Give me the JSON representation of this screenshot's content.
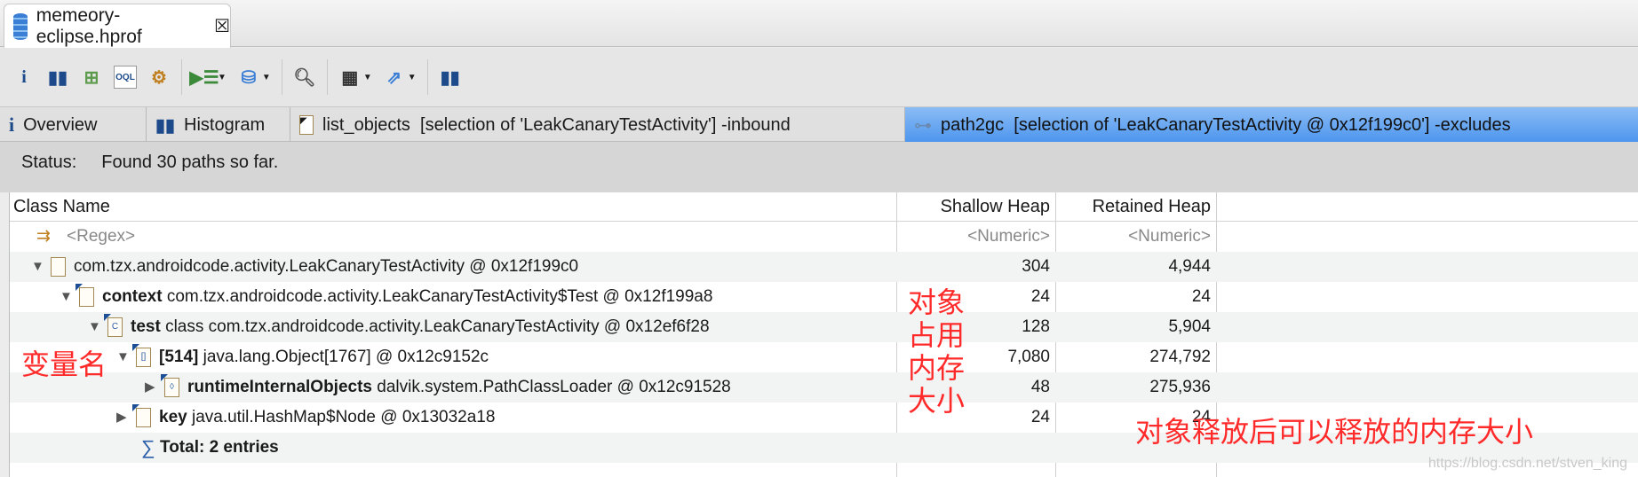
{
  "editor_tab": {
    "title": "memeory-eclipse.hprof",
    "close": "☒"
  },
  "toolbar": {
    "icons": [
      "info-icon",
      "histogram-icon",
      "dominator-tree-icon",
      "oql-icon",
      "gear-icon",
      "query-browser-icon",
      "heap-dump-icon",
      "search-icon",
      "calculator-icon",
      "export-icon",
      "leak-suspects-icon"
    ]
  },
  "subtabs": [
    {
      "label": "Overview"
    },
    {
      "label": "Histogram"
    },
    {
      "label": "list_objects  [selection of 'LeakCanaryTestActivity'] -inbound"
    },
    {
      "label": "path2gc  [selection of 'LeakCanaryTestActivity @ 0x12f199c0'] -excludes"
    }
  ],
  "status": {
    "label": "Status:",
    "text": "Found 30 paths so far."
  },
  "columns": {
    "class_name": "Class Name",
    "shallow": "Shallow Heap",
    "retained": "Retained Heap"
  },
  "filter": {
    "regex": "<Regex>",
    "shallow": "<Numeric>",
    "retained": "<Numeric>"
  },
  "rows": [
    {
      "field": "",
      "text": "com.tzx.androidcode.activity.LeakCanaryTestActivity @ 0x12f199c0",
      "shallow": "304",
      "retained": "4,944"
    },
    {
      "field": "context",
      "text": "com.tzx.androidcode.activity.LeakCanaryTestActivity$Test @ 0x12f199a8",
      "shallow": "24",
      "retained": "24"
    },
    {
      "field": "test",
      "text": "class com.tzx.androidcode.activity.LeakCanaryTestActivity @ 0x12ef6f28",
      "shallow": "128",
      "retained": "5,904"
    },
    {
      "field": "[514]",
      "text": "java.lang.Object[1767] @ 0x12c9152c",
      "shallow": "7,080",
      "retained": "274,792"
    },
    {
      "field": "runtimeInternalObjects",
      "text": "dalvik.system.PathClassLoader @ 0x12c91528",
      "shallow": "48",
      "retained": "275,936"
    },
    {
      "field": "key",
      "text": "java.util.HashMap$Node @ 0x13032a18",
      "shallow": "24",
      "retained": "24"
    }
  ],
  "total": "Total: 2 entries",
  "annotations": {
    "var_name": "变量名",
    "shallow_note": [
      "对象",
      "占用",
      "内存",
      "大小"
    ],
    "retained_note": "对象释放后可以释放的内存大小"
  },
  "watermark": "https://blog.csdn.net/stven_king"
}
